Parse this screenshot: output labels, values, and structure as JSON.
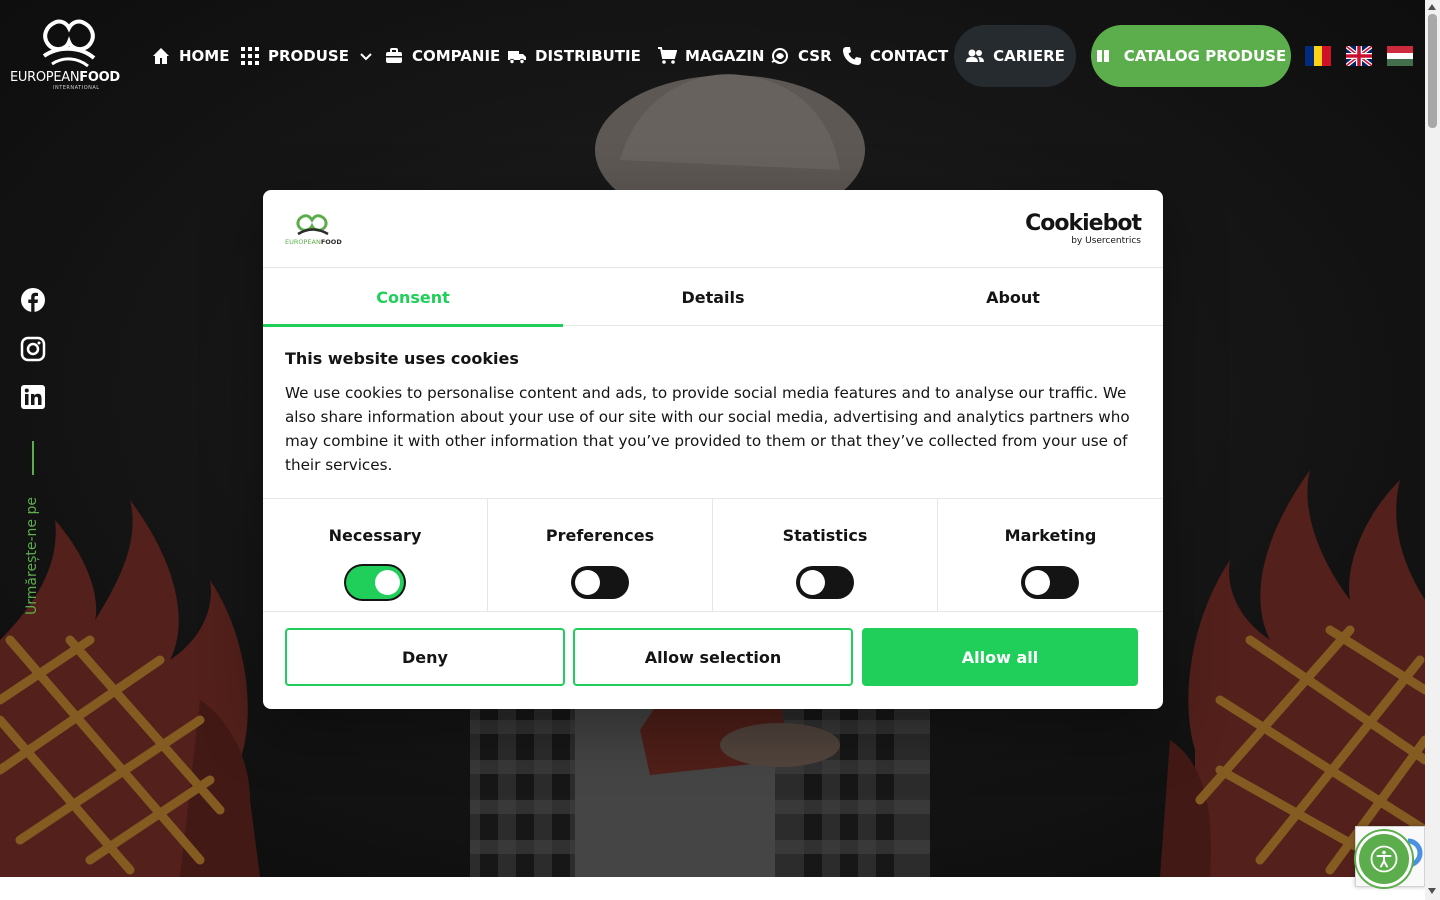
{
  "header": {
    "logo_text_bold": "FOOD",
    "logo_text_light": "EUROPEAN",
    "logo_sub": "INTERNATIONAL",
    "nav": [
      {
        "label": "HOME",
        "icon": "home-icon"
      },
      {
        "label": "PRODUSE",
        "icon": "grid-icon"
      },
      {
        "label": "COMPANIE",
        "icon": "briefcase-icon"
      },
      {
        "label": "DISTRIBUTIE",
        "icon": "truck-icon"
      },
      {
        "label": "MAGAZIN",
        "icon": "cart-icon"
      },
      {
        "label": "CSR",
        "icon": "csr-icon"
      },
      {
        "label": "CONTACT",
        "icon": "phone-icon"
      }
    ],
    "cariere_label": "CARIERE",
    "catalog_label": "CATALOG PRODUSE",
    "flags": [
      "romania-flag",
      "uk-flag",
      "hungary-flag"
    ]
  },
  "social": {
    "follow_text": "Urmărește-ne pe",
    "items": [
      "facebook-icon",
      "instagram-icon",
      "linkedin-icon"
    ]
  },
  "cookie": {
    "brand": "Cookiebot",
    "brand_sub": "by Usercentrics",
    "tabs": [
      "Consent",
      "Details",
      "About"
    ],
    "active_tab": "Consent",
    "title": "This website uses cookies",
    "text": "We use cookies to personalise content and ads, to provide social media features and to analyse our traffic. We also share information about your use of our site with our social media, advertising and analytics partners who may combine it with other information that you’ve provided to them or that they’ve collected from your use of their services.",
    "toggles": [
      {
        "label": "Necessary",
        "on": true
      },
      {
        "label": "Preferences",
        "on": false
      },
      {
        "label": "Statistics",
        "on": false
      },
      {
        "label": "Marketing",
        "on": false
      }
    ],
    "deny_label": "Deny",
    "allow_selection_label": "Allow selection",
    "allow_all_label": "Allow all"
  },
  "colors": {
    "brand_green": "#5cae4c",
    "cookie_green": "#1fcf5a",
    "hero_dark": "#161616",
    "flame_red": "#6f2b24",
    "grill_gold": "#b07a2c"
  }
}
